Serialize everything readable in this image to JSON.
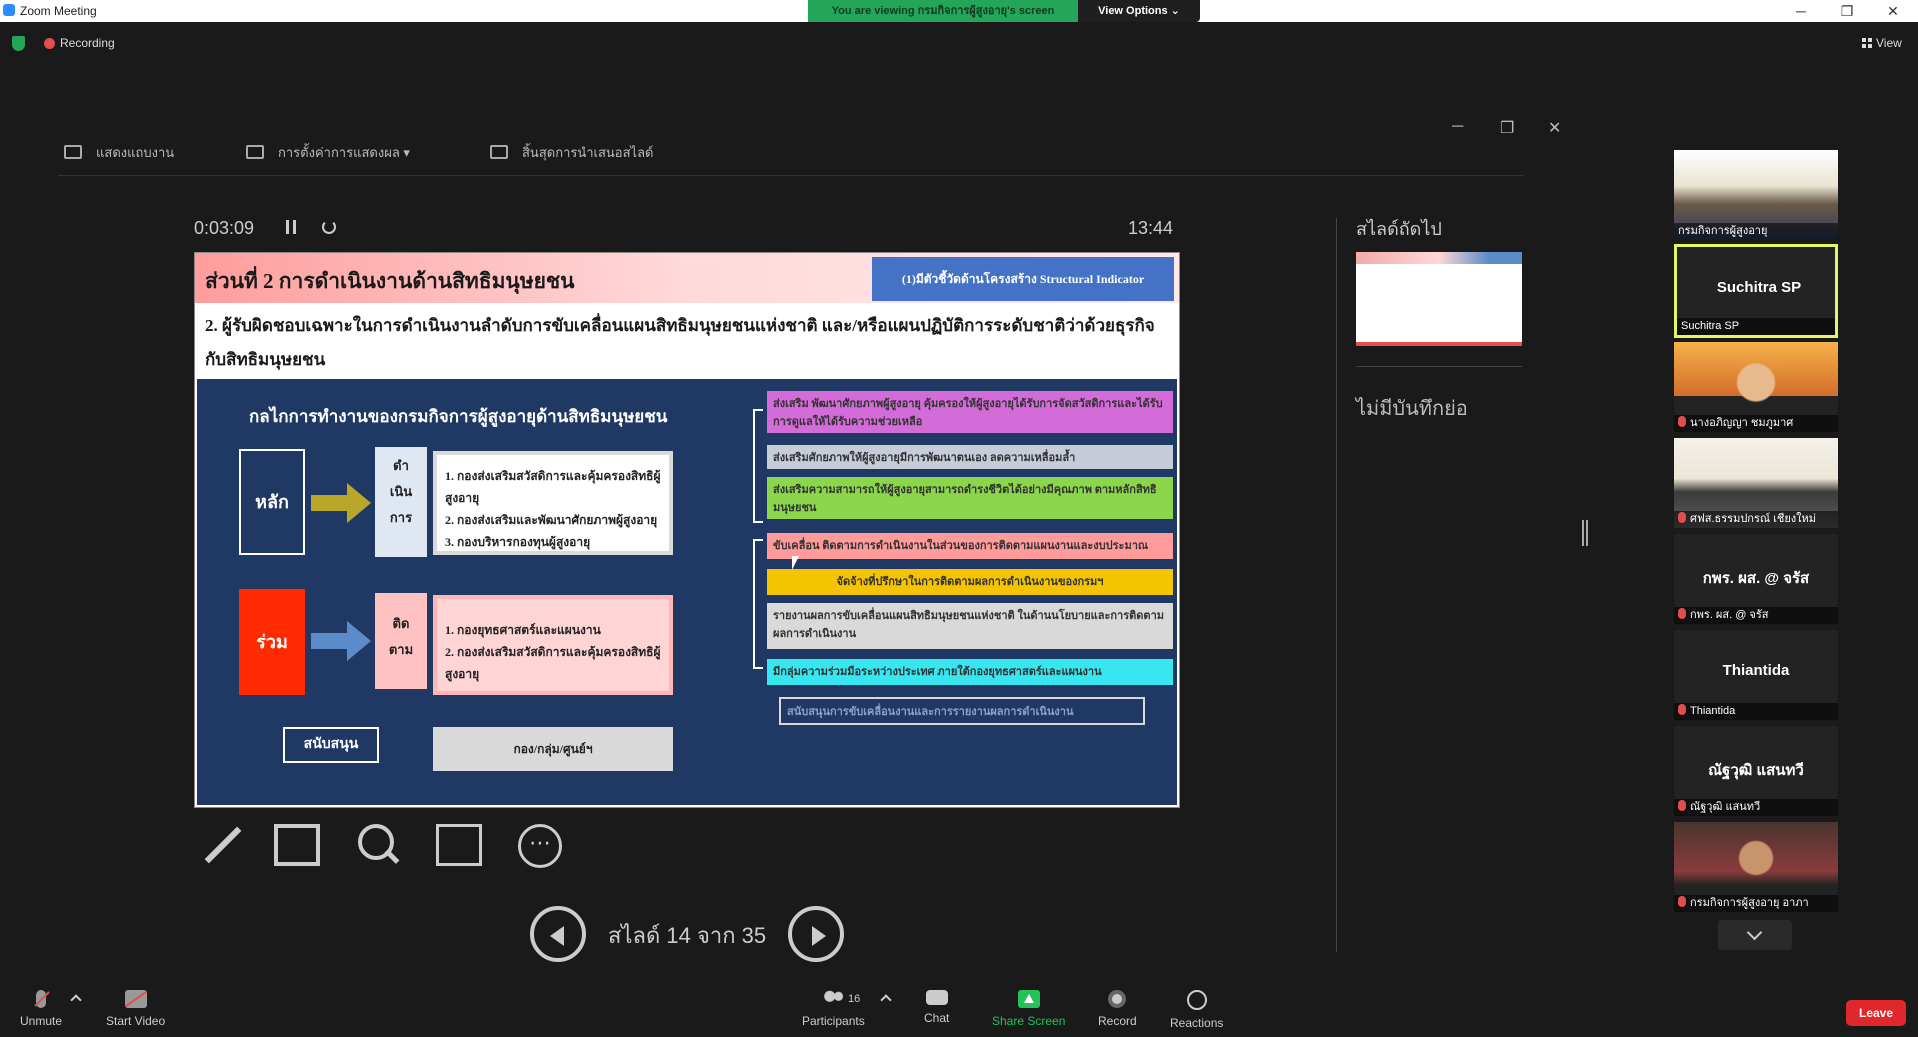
{
  "window": {
    "title": "Zoom Meeting",
    "viewing_banner": "You are viewing กรมกิจการผู้สูงอายุ's screen",
    "view_options": "View Options ⌄",
    "minimize": "─",
    "restore": "❐",
    "close": "✕"
  },
  "meeting": {
    "recording_label": "Recording",
    "view_label": "View"
  },
  "presenter_toolbar": {
    "items": [
      {
        "label": "แสดงแถบงาน"
      },
      {
        "label": "การตั้งค่าการแสดงผล ▾"
      },
      {
        "label": "สิ้นสุดการนำเสนอสไลด์"
      }
    ],
    "minimize": "─",
    "restore": "❐",
    "close": "✕"
  },
  "presenter": {
    "elapsed": "0:03:09",
    "clock": "13:44",
    "slide_counter": "สไลด์ 14 จาก 35",
    "next_slide_label": "สไลด์ถัดไป",
    "no_notes": "ไม่มีบันทึกย่อ",
    "more": "⋯"
  },
  "slide": {
    "title": "ส่วนที่ 2 การดำเนินงานด้านสิทธิมนุษยชน",
    "indicator": "(1)มีตัวชี้วัดด้านโครงสร้าง Structural Indicator",
    "subtitle": "2. ผู้รับผิดชอบเฉพาะในการดำเนินงานลำดับการขับเคลื่อนแผนสิทธิมนุษยชนแห่งชาติ และ/หรือแผนปฏิบัติการระดับชาติว่าด้วยธุรกิจกับสิทธิมนุษยชน",
    "panel_title": "กลไกการทำงานของกรมกิจการผู้สูงอายุด้านสิทธิมนุษยชน",
    "main_label": "หลัก",
    "joint_label": "ร่วม",
    "step_operate": "ดำ\nเนิน\nการ",
    "step_follow": "ติด\nตาม",
    "main_units": [
      "1. กองส่งเสริมสวัสดิการและคุ้มครองสิทธิผู้สูงอายุ",
      "2. กองส่งเสริมและพัฒนาศักยภาพผู้สูงอายุ",
      "3. กองบริหารกองทุนผู้สูงอายุ"
    ],
    "joint_units": [
      "1. กองยุทธศาสตร์และแผนงาน",
      "2. กองส่งเสริมสวัสดิการและคุ้มครองสิทธิผู้สูงอายุ"
    ],
    "support_label": "สนับสนุน",
    "support_units": "กอง/กลุ่ม/ศูนย์ฯ",
    "right_items": [
      {
        "text": "ส่งเสริม พัฒนาศักยภาพผู้สูงอายุ คุ้มครองให้ผู้สูงอายุได้รับการจัดสวัสดิการและได้รับการดูแลให้ได้รับความช่วยเหลือ",
        "color": "#d36bd8"
      },
      {
        "text": "ส่งเสริมศักยภาพให้ผู้สูงอายุมีการพัฒนาตนเอง ลดความเหลื่อมล้ำ",
        "color": "#c7ccd9"
      },
      {
        "text": "ส่งเสริมความสามารถให้ผู้สูงอายุสามารถดำรงชีวิตได้อย่างมีคุณภาพ ตามหลักสิทธิมนุษยชน",
        "color": "#8bd64b"
      },
      {
        "text": "ขับเคลื่อน ติดตามการดำเนินงานในส่วนของการติดตามแผนงานและงบประมาณ",
        "color": "#ff9b9b"
      },
      {
        "text": "จัดจ้างที่ปรึกษาในการติดตามผลการดำเนินงานของกรมฯ",
        "color": "#f5c400"
      },
      {
        "text": "รายงานผลการขับเคลื่อนแผนสิทธิมนุษยชนแห่งชาติ ในด้านนโยบายและการติดตามผลการดำเนินงาน",
        "color": "#d9d9d9"
      },
      {
        "text": "มีกลุ่มความร่วมมือระหว่างประเทศ ภายใต้กองยุทธศาสตร์และแผนงาน",
        "color": "#38e6f0"
      },
      {
        "text": "สนับสนุนการขับเคลื่อนงานและการรายงานผลการดำเนินงาน",
        "color": "#1f3864"
      }
    ]
  },
  "participants": [
    {
      "name": "กรมกิจการผู้สูงอายุ",
      "muted": false,
      "type": "video"
    },
    {
      "name": "Suchitra SP",
      "muted": false,
      "type": "name",
      "active": true
    },
    {
      "name": "นางอภิญญา ชมภูมาศ",
      "muted": true,
      "type": "video"
    },
    {
      "name": "ศฟส.ธรรมปกรณ์ เชียงใหม่",
      "muted": true,
      "type": "video"
    },
    {
      "name": "กพร. ผส. @ จรัส",
      "muted": true,
      "type": "name"
    },
    {
      "name": "Thiantida",
      "muted": true,
      "type": "name"
    },
    {
      "name": "ณัฐวุฒิ แสนทวี",
      "muted": true,
      "type": "name"
    },
    {
      "name": "กรมกิจการผู้สูงอายุ อาภา",
      "muted": true,
      "type": "video"
    }
  ],
  "bottombar": {
    "unmute": "Unmute",
    "start_video": "Start Video",
    "participants": "Participants",
    "participants_count": "16",
    "chat": "Chat",
    "share_screen": "Share Screen",
    "record": "Record",
    "reactions": "Reactions",
    "leave": "Leave"
  }
}
